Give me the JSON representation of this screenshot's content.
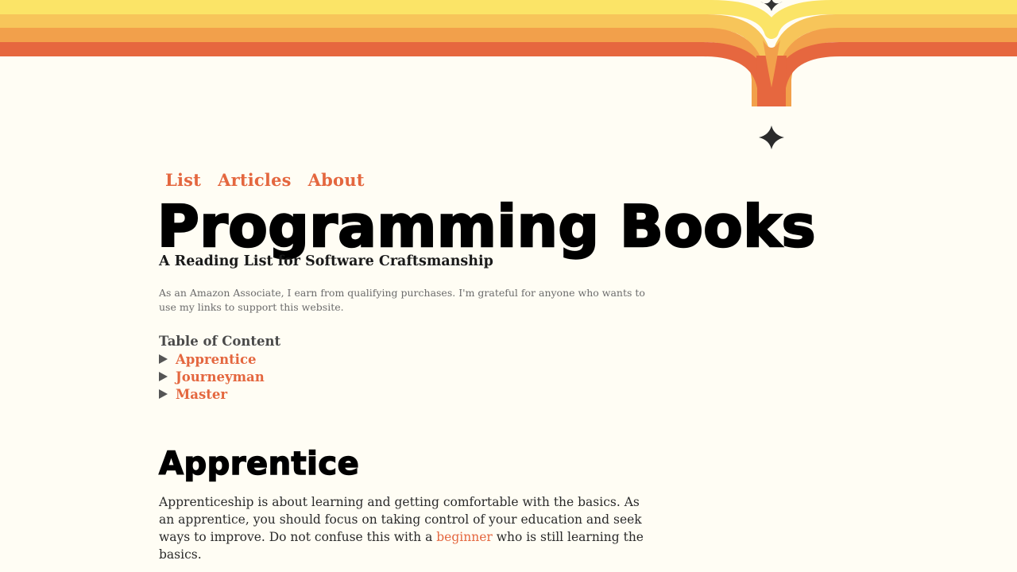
{
  "nav": {
    "items": [
      {
        "label": "List"
      },
      {
        "label": "Articles"
      },
      {
        "label": "About"
      }
    ]
  },
  "header": {
    "title": "Programming Books",
    "subtitle": "A Reading List for Software Craftsmanship"
  },
  "disclaimer": "As an Amazon Associate, I earn from qualifying purchases. I'm grateful for anyone who wants to use my links to support this website.",
  "toc": {
    "title": "Table of Content",
    "items": [
      {
        "label": "Apprentice"
      },
      {
        "label": "Journeyman"
      },
      {
        "label": "Master"
      }
    ]
  },
  "section": {
    "title": "Apprentice",
    "body_before": "Apprenticeship is about learning and getting comfortable with the basics. As an apprentice, you should focus on taking control of your education and seek ways to improve. Do not confuse this with a ",
    "link": "beginner",
    "body_after": " who is still learning the basics."
  },
  "colors": {
    "background": "#fffdf4",
    "accent": "#e4673f",
    "stripe_yellow": "#fbe467",
    "stripe_light_orange": "#f7c55a",
    "stripe_orange": "#f2a04b",
    "stripe_red": "#e6673f"
  },
  "icons": [
    "sparkle-icon",
    "disclosure-triangle-icon"
  ]
}
